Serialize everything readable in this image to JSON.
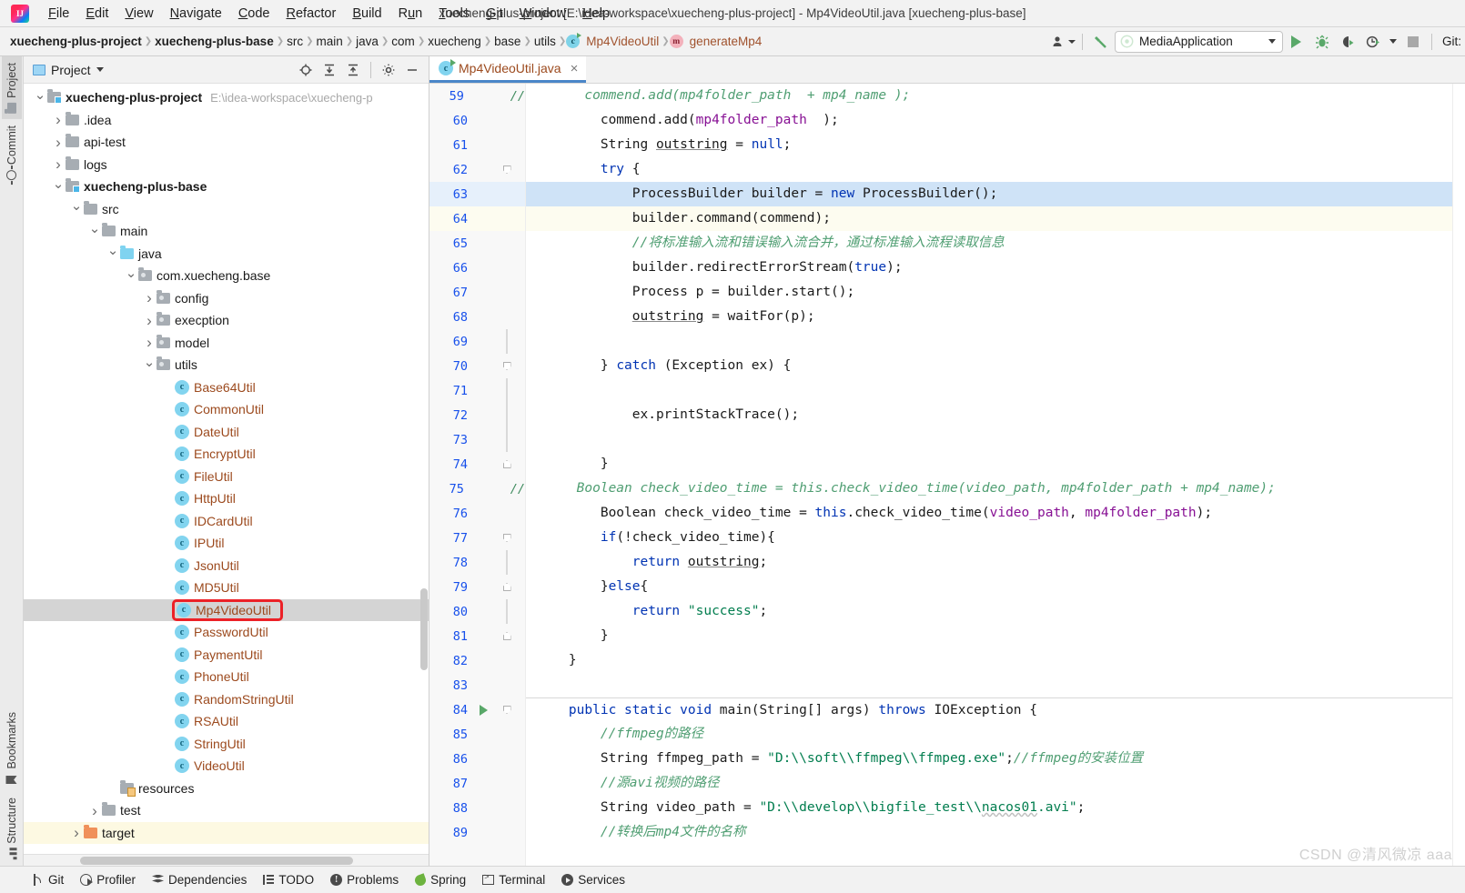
{
  "window": {
    "title": "xuecheng-plus-project [E:\\idea-workspace\\xuecheng-plus-project] - Mp4VideoUtil.java [xuecheng-plus-base]",
    "logo": "intellij-idea-logo"
  },
  "menu": {
    "items": [
      {
        "label": "File",
        "mnemonic": "F"
      },
      {
        "label": "Edit",
        "mnemonic": "E"
      },
      {
        "label": "View",
        "mnemonic": "V"
      },
      {
        "label": "Navigate",
        "mnemonic": "N"
      },
      {
        "label": "Code",
        "mnemonic": "C"
      },
      {
        "label": "Refactor",
        "mnemonic": "R"
      },
      {
        "label": "Build",
        "mnemonic": "B"
      },
      {
        "label": "Run",
        "mnemonic": "u"
      },
      {
        "label": "Tools",
        "mnemonic": "T"
      },
      {
        "label": "Git",
        "mnemonic": "G"
      },
      {
        "label": "Window",
        "mnemonic": "W"
      },
      {
        "label": "Help",
        "mnemonic": "H"
      }
    ]
  },
  "breadcrumbs": [
    {
      "label": "xuecheng-plus-project",
      "bold": true,
      "icon": ""
    },
    {
      "label": "xuecheng-plus-base",
      "bold": true,
      "icon": ""
    },
    {
      "label": "src",
      "bold": false,
      "icon": ""
    },
    {
      "label": "main",
      "bold": false,
      "icon": ""
    },
    {
      "label": "java",
      "bold": false,
      "icon": ""
    },
    {
      "label": "com",
      "bold": false,
      "icon": ""
    },
    {
      "label": "xuecheng",
      "bold": false,
      "icon": ""
    },
    {
      "label": "base",
      "bold": false,
      "icon": ""
    },
    {
      "label": "utils",
      "bold": false,
      "icon": ""
    },
    {
      "label": "Mp4VideoUtil",
      "bold": false,
      "icon": "class-icon",
      "kind": "class"
    },
    {
      "label": "generateMp4",
      "bold": false,
      "icon": "method-icon",
      "kind": "method"
    }
  ],
  "toolbar": {
    "run_config": "MediaApplication",
    "run_config_icon": "spring-boot-icon",
    "buttons": [
      {
        "name": "user-settings-icon",
        "title": "Select Run/Debug"
      },
      {
        "name": "build-hammer-icon",
        "title": "Build Project"
      },
      {
        "name": "run-button",
        "title": "Run"
      },
      {
        "name": "debug-button",
        "title": "Debug"
      },
      {
        "name": "run-coverage-button",
        "title": "Run with Coverage"
      },
      {
        "name": "profiler-button",
        "title": "Profiler"
      },
      {
        "name": "stop-button",
        "title": "Stop"
      }
    ],
    "git_label": "Git:"
  },
  "left_strip": {
    "top_tabs": [
      {
        "label": "Project",
        "icon": "project-folder-icon",
        "active": true
      },
      {
        "label": "Commit",
        "icon": "commit-icon",
        "active": false
      }
    ],
    "bottom_tabs": [
      {
        "label": "Bookmarks",
        "icon": "bookmark-icon",
        "active": false
      },
      {
        "label": "Structure",
        "icon": "structure-icon",
        "active": false
      }
    ]
  },
  "project_panel": {
    "title": "Project",
    "actions": [
      {
        "name": "locate-target-icon"
      },
      {
        "name": "expand-all-icon"
      },
      {
        "name": "collapse-all-icon"
      },
      {
        "name": "settings-gear-icon"
      },
      {
        "name": "hide-panel-icon"
      }
    ],
    "tree": [
      {
        "depth": 0,
        "arrow": "down",
        "icon": "module-folder",
        "label": "xuecheng-plus-project",
        "bold": true,
        "path": "E:\\idea-workspace\\xuecheng-p",
        "kind": "module"
      },
      {
        "depth": 1,
        "arrow": "right",
        "icon": "folder",
        "label": ".idea",
        "bold": false,
        "kind": "folder"
      },
      {
        "depth": 1,
        "arrow": "right",
        "icon": "folder",
        "label": "api-test",
        "bold": false,
        "kind": "folder"
      },
      {
        "depth": 1,
        "arrow": "right",
        "icon": "folder",
        "label": "logs",
        "bold": false,
        "kind": "folder"
      },
      {
        "depth": 1,
        "arrow": "down",
        "icon": "module-folder",
        "label": "xuecheng-plus-base",
        "bold": true,
        "kind": "module"
      },
      {
        "depth": 2,
        "arrow": "down",
        "icon": "folder",
        "label": "src",
        "bold": false,
        "kind": "folder"
      },
      {
        "depth": 3,
        "arrow": "down",
        "icon": "folder",
        "label": "main",
        "bold": false,
        "kind": "folder"
      },
      {
        "depth": 4,
        "arrow": "down",
        "icon": "source-folder",
        "label": "java",
        "bold": false,
        "kind": "source"
      },
      {
        "depth": 5,
        "arrow": "down",
        "icon": "package",
        "label": "com.xuecheng.base",
        "bold": false,
        "kind": "package"
      },
      {
        "depth": 6,
        "arrow": "right",
        "icon": "package",
        "label": "config",
        "bold": false,
        "kind": "package"
      },
      {
        "depth": 6,
        "arrow": "right",
        "icon": "package",
        "label": "execption",
        "bold": false,
        "kind": "package"
      },
      {
        "depth": 6,
        "arrow": "right",
        "icon": "package",
        "label": "model",
        "bold": false,
        "kind": "package"
      },
      {
        "depth": 6,
        "arrow": "down",
        "icon": "package",
        "label": "utils",
        "bold": false,
        "kind": "package"
      },
      {
        "depth": 7,
        "arrow": "none",
        "icon": "class",
        "label": "Base64Util",
        "kind": "class"
      },
      {
        "depth": 7,
        "arrow": "none",
        "icon": "class-runnable",
        "label": "CommonUtil",
        "kind": "class"
      },
      {
        "depth": 7,
        "arrow": "none",
        "icon": "class",
        "label": "DateUtil",
        "kind": "class"
      },
      {
        "depth": 7,
        "arrow": "none",
        "icon": "class-runnable",
        "label": "EncryptUtil",
        "kind": "class"
      },
      {
        "depth": 7,
        "arrow": "none",
        "icon": "class",
        "label": "FileUtil",
        "kind": "class"
      },
      {
        "depth": 7,
        "arrow": "none",
        "icon": "class",
        "label": "HttpUtil",
        "kind": "class"
      },
      {
        "depth": 7,
        "arrow": "none",
        "icon": "class-runnable",
        "label": "IDCardUtil",
        "kind": "class"
      },
      {
        "depth": 7,
        "arrow": "none",
        "icon": "class",
        "label": "IPUtil",
        "kind": "class"
      },
      {
        "depth": 7,
        "arrow": "none",
        "icon": "class",
        "label": "JsonUtil",
        "kind": "class"
      },
      {
        "depth": 7,
        "arrow": "none",
        "icon": "class",
        "label": "MD5Util",
        "kind": "class"
      },
      {
        "depth": 7,
        "arrow": "none",
        "icon": "class-runnable",
        "label": "Mp4VideoUtil",
        "kind": "class",
        "selected": true,
        "highlighted": true
      },
      {
        "depth": 7,
        "arrow": "none",
        "icon": "class",
        "label": "PasswordUtil",
        "kind": "class"
      },
      {
        "depth": 7,
        "arrow": "none",
        "icon": "class-runnable",
        "label": "PaymentUtil",
        "kind": "class"
      },
      {
        "depth": 7,
        "arrow": "none",
        "icon": "class",
        "label": "PhoneUtil",
        "kind": "class"
      },
      {
        "depth": 7,
        "arrow": "none",
        "icon": "class",
        "label": "RandomStringUtil",
        "kind": "class"
      },
      {
        "depth": 7,
        "arrow": "none",
        "icon": "class-runnable",
        "label": "RSAUtil",
        "kind": "class"
      },
      {
        "depth": 7,
        "arrow": "none",
        "icon": "class",
        "label": "StringUtil",
        "kind": "class"
      },
      {
        "depth": 7,
        "arrow": "none",
        "icon": "class-runnable",
        "label": "VideoUtil",
        "kind": "class"
      },
      {
        "depth": 4,
        "arrow": "none",
        "icon": "resource-folder",
        "label": "resources",
        "bold": false,
        "kind": "resources"
      },
      {
        "depth": 3,
        "arrow": "right",
        "icon": "folder",
        "label": "test",
        "bold": false,
        "kind": "folder"
      },
      {
        "depth": 2,
        "arrow": "right",
        "icon": "target-folder",
        "label": "target",
        "bold": false,
        "kind": "target",
        "excluded": true
      }
    ]
  },
  "editor": {
    "tab": {
      "label": "Mp4VideoUtil.java",
      "icon": "class-runnable-icon",
      "close": "×"
    },
    "first_line_number": 59,
    "lines": [
      {
        "n": 59,
        "gutter_comment": "//",
        "fold": "",
        "html": "      <span class='cm'>commend.add(mp4folder_path  + mp4_name );</span>"
      },
      {
        "n": 60,
        "gutter_comment": "",
        "fold": "",
        "html": "        commend.add(<span class='fld'>mp4folder_path</span>  );"
      },
      {
        "n": 61,
        "gutter_comment": "",
        "fold": "",
        "html": "        String <span class='und'>outstring</span> = <span class='kw'>null</span>;"
      },
      {
        "n": 62,
        "gutter_comment": "",
        "fold": "close",
        "html": "        <span class='kw'>try</span> {"
      },
      {
        "n": 63,
        "gutter_comment": "",
        "fold": "",
        "highlight": "caret",
        "html": "            ProcessBuilder builder = <span class='kw'>new</span> ProcessBuilder();"
      },
      {
        "n": 64,
        "gutter_comment": "",
        "fold": "",
        "highlight": "soft",
        "html": "            builder.command(commend);"
      },
      {
        "n": 65,
        "gutter_comment": "",
        "fold": "",
        "html": "            <span class='cm'>//将标准输入流和错误输入流合并，通过标准输入流程读取信息</span>"
      },
      {
        "n": 66,
        "gutter_comment": "",
        "fold": "",
        "html": "            builder.redirectErrorStream(<span class='kw'>true</span>);"
      },
      {
        "n": 67,
        "gutter_comment": "",
        "fold": "",
        "html": "            Process p = builder.start();"
      },
      {
        "n": 68,
        "gutter_comment": "",
        "fold": "",
        "html": "            <span class='und'>outstring</span> = waitFor(p);"
      },
      {
        "n": 69,
        "gutter_comment": "",
        "fold": "bar",
        "html": ""
      },
      {
        "n": 70,
        "gutter_comment": "",
        "fold": "close",
        "html": "        } <span class='kw'>catch</span> (Exception ex) {"
      },
      {
        "n": 71,
        "gutter_comment": "",
        "fold": "bar",
        "html": ""
      },
      {
        "n": 72,
        "gutter_comment": "",
        "fold": "bar",
        "html": "            ex.printStackTrace();"
      },
      {
        "n": 73,
        "gutter_comment": "",
        "fold": "bar",
        "html": ""
      },
      {
        "n": 74,
        "gutter_comment": "",
        "fold": "open",
        "html": "        }"
      },
      {
        "n": 75,
        "gutter_comment": "//",
        "fold": "",
        "html": "     <span class='cm'>Boolean check_video_time = this.check_video_time(video_path, mp4folder_path + mp4_name);</span>"
      },
      {
        "n": 76,
        "gutter_comment": "",
        "fold": "",
        "html": "        Boolean check_video_time = <span class='kw'>this</span>.check_video_time(<span class='fld'>video_path</span>, <span class='fld'>mp4folder_path</span>);"
      },
      {
        "n": 77,
        "gutter_comment": "",
        "fold": "close",
        "html": "        <span class='kw'>if</span>(!check_video_time){"
      },
      {
        "n": 78,
        "gutter_comment": "",
        "fold": "bar",
        "html": "            <span class='kw'>return</span> <span class='und'>outstring</span>;"
      },
      {
        "n": 79,
        "gutter_comment": "",
        "fold": "open",
        "html": "        }<span class='kw'>else</span>{"
      },
      {
        "n": 80,
        "gutter_comment": "",
        "fold": "bar",
        "html": "            <span class='kw'>return</span> <span class='str'>\"success\"</span>;"
      },
      {
        "n": 81,
        "gutter_comment": "",
        "fold": "open",
        "html": "        }"
      },
      {
        "n": 82,
        "gutter_comment": "",
        "fold": "",
        "html": "    }"
      },
      {
        "n": 83,
        "gutter_comment": "",
        "fold": "",
        "html": ""
      },
      {
        "n": 84,
        "gutter_comment": "",
        "fold": "close",
        "run_marker": true,
        "separator": true,
        "html": "    <span class='kw'>public static void</span> main(String[] args) <span class='kw'>throws</span> IOException {"
      },
      {
        "n": 85,
        "gutter_comment": "",
        "fold": "",
        "html": "        <span class='cm'>//ffmpeg的路径</span>"
      },
      {
        "n": 86,
        "gutter_comment": "",
        "fold": "",
        "html": "        String ffmpeg_path = <span class='str'>\"D:\\\\soft\\\\ffmpeg\\\\ffmpeg.exe\"</span>;<span class='cm'>//ffmpeg的安装位置</span>"
      },
      {
        "n": 87,
        "gutter_comment": "",
        "fold": "",
        "html": "        <span class='cm'>//源avi视频的路径</span>"
      },
      {
        "n": 88,
        "gutter_comment": "",
        "fold": "",
        "html": "        String video_path = <span class='str'>\"D:\\\\develop\\\\bigfile_test\\\\<span class='wavy'>nacos01</span>.avi\"</span>;"
      },
      {
        "n": 89,
        "gutter_comment": "",
        "fold": "",
        "html": "        <span class='cm'>//转换后mp4文件的名称</span>"
      }
    ]
  },
  "statusbar": {
    "items": [
      {
        "label": "Git",
        "icon": "git-branch-icon"
      },
      {
        "label": "Profiler",
        "icon": "profiler-icon"
      },
      {
        "label": "Dependencies",
        "icon": "dependencies-icon"
      },
      {
        "label": "TODO",
        "icon": "todo-list-icon"
      },
      {
        "label": "Problems",
        "icon": "problems-icon"
      },
      {
        "label": "Spring",
        "icon": "spring-leaf-icon"
      },
      {
        "label": "Terminal",
        "icon": "terminal-icon"
      },
      {
        "label": "Services",
        "icon": "services-icon"
      }
    ]
  },
  "watermark": "CSDN @清风微凉 aaa",
  "colors": {
    "accent": "#4a86c8",
    "highlight_red": "#ec2127",
    "run_green": "#59a869",
    "class_text": "#9c4a1e",
    "keyword": "#0033b3",
    "string": "#017d4e",
    "comment": "#4f9e72",
    "field": "#871094",
    "selection": "#cfe3f7"
  }
}
